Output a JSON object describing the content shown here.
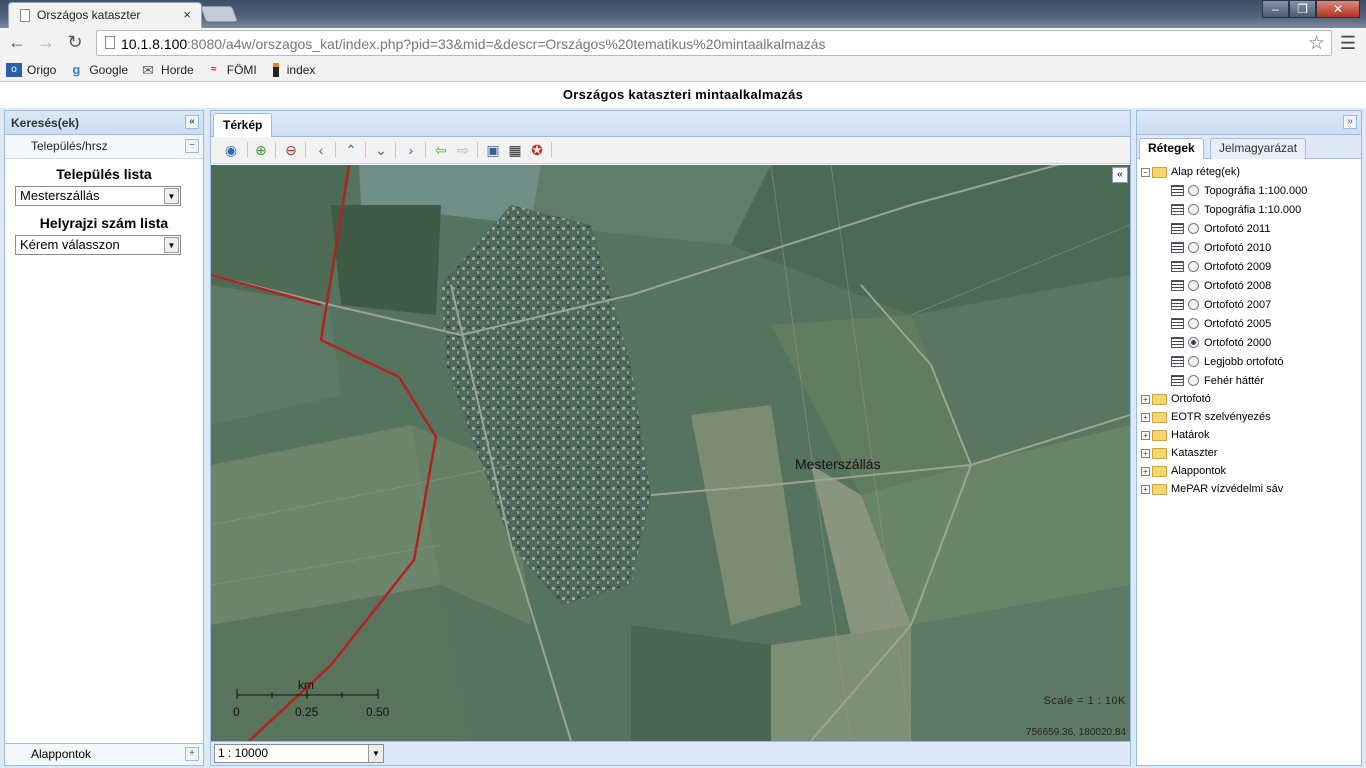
{
  "browser": {
    "tab_title": "Országos kataszter",
    "tab_close": "×",
    "url_host": "10.1.8.100",
    "url_rest": ":8080/a4w/orszagos_kat/index.php?pid=33&mid=&descr=Országos%20tematikus%20mintaalkalmazás",
    "window_controls": [
      "–",
      "❐",
      "✕"
    ]
  },
  "bookmarks": [
    {
      "label": "Origo",
      "icon": "origo-icon"
    },
    {
      "label": "Google",
      "icon": "google-icon"
    },
    {
      "label": "Horde",
      "icon": "mail-icon"
    },
    {
      "label": "FÖMI",
      "icon": "fomi-icon"
    },
    {
      "label": "index",
      "icon": "index-icon"
    }
  ],
  "app": {
    "title": "Országos kataszteri mintaalkalmazás"
  },
  "left_panel": {
    "header": "Keresés(ek)",
    "section": "Település/hrsz",
    "settlement_list_title": "Település lista",
    "settlement_value": "Mesterszállás",
    "parcel_list_title": "Helyrajzi szám lista",
    "parcel_value": "Kérem válasszon",
    "bottom_section": "Alappontok"
  },
  "center": {
    "tab": "Térkép",
    "map_place_label": "Mesterszállás",
    "scale_text": "Scale = 1 : 10K",
    "coordinates": "756659.36, 180020.84",
    "scalebar": {
      "unit": "km",
      "ticks": [
        "0",
        "0.25",
        "0.50"
      ]
    },
    "scale_select": "1 : 10000",
    "collapse": "«"
  },
  "right_panel": {
    "tabs": [
      "Rétegek",
      "Jelmagyarázat"
    ],
    "base_folder": "Alap réteg(ek)",
    "base_layers": [
      {
        "label": "Topográfia 1:100.000",
        "selected": false
      },
      {
        "label": "Topográfia 1:10.000",
        "selected": false
      },
      {
        "label": "Ortofotó 2011",
        "selected": false
      },
      {
        "label": "Ortofotó 2010",
        "selected": false
      },
      {
        "label": "Ortofotó 2009",
        "selected": false
      },
      {
        "label": "Ortofotó 2008",
        "selected": false
      },
      {
        "label": "Ortofotó 2007",
        "selected": false
      },
      {
        "label": "Ortofotó 2005",
        "selected": false
      },
      {
        "label": "Ortofotó 2000",
        "selected": true
      },
      {
        "label": "Legjobb ortofotó",
        "selected": false
      },
      {
        "label": "Fehér háttér",
        "selected": false
      }
    ],
    "folders": [
      "Ortofotó",
      "EOTR szelvényezés",
      "Határok",
      "Kataszter",
      "Alappontok",
      "MePAR vízvédelmi sáv"
    ]
  }
}
